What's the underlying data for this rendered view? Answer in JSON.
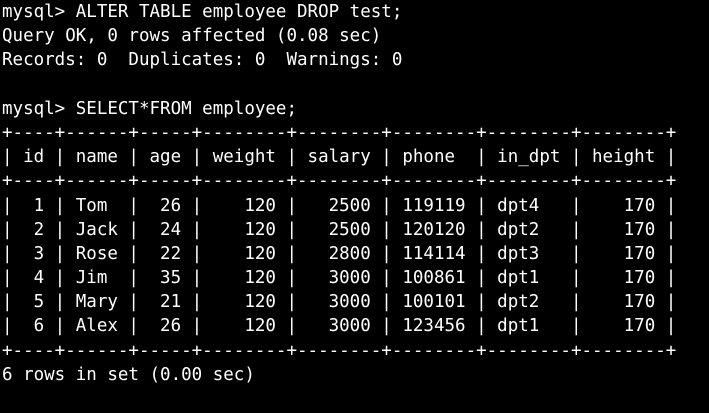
{
  "terminal": {
    "lines": [
      "mysql> ALTER TABLE employee DROP test;",
      "Query OK, 0 rows affected (0.08 sec)",
      "Records: 0  Duplicates: 0  Warnings: 0",
      "",
      "mysql> SELECT*FROM employee;",
      "+----+------+-----+--------+--------+--------+--------+--------+",
      "| id | name | age | weight | salary | phone  | in_dpt | height |",
      "+----+------+-----+--------+--------+--------+--------+--------+",
      "|  1 | Tom  |  26 |    120 |   2500 | 119119 | dpt4   |    170 |",
      "|  2 | Jack |  24 |    120 |   2500 | 120120 | dpt2   |    170 |",
      "|  3 | Rose |  22 |    120 |   2800 | 114114 | dpt3   |    170 |",
      "|  4 | Jim  |  35 |    120 |   3000 | 100861 | dpt1   |    170 |",
      "|  5 | Mary |  21 |    120 |   3000 | 100101 | dpt2   |    170 |",
      "|  6 | Alex |  26 |    120 |   3000 | 123456 | dpt1   |    170 |",
      "+----+------+-----+--------+--------+--------+--------+--------+",
      "6 rows in set (0.00 sec)"
    ]
  },
  "colors": {
    "background": "#000000",
    "text": "#ffffff"
  }
}
